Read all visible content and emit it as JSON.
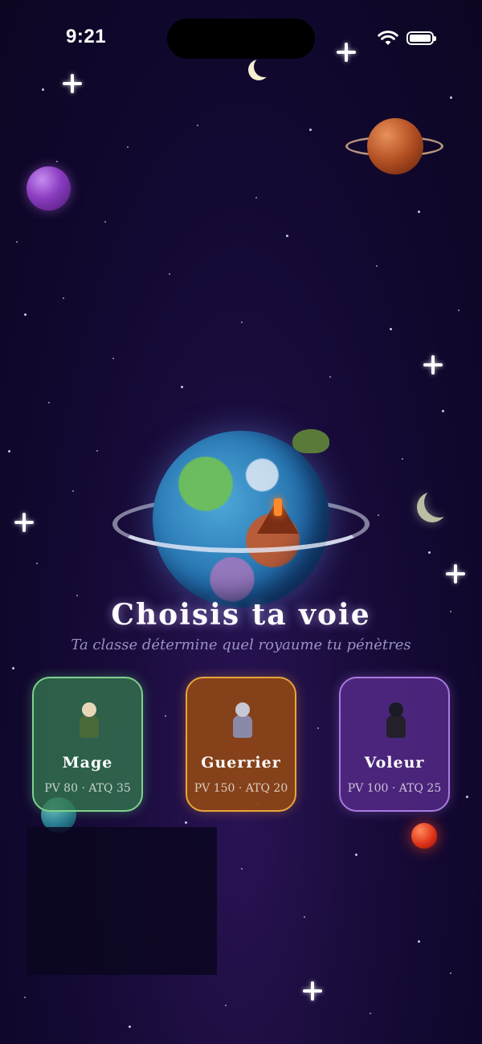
{
  "status_bar": {
    "time": "9:21"
  },
  "title": "Choisis ta voie",
  "subtitle": "Ta classe détermine quel royaume tu pénètres",
  "classes": [
    {
      "name": "Mage",
      "stats": "PV 80 · ATQ 35",
      "color": "#7fd18e"
    },
    {
      "name": "Guerrier",
      "stats": "PV 150 · ATQ 20",
      "color": "#e8a63a"
    },
    {
      "name": "Voleur",
      "stats": "PV 100 · ATQ 25",
      "color": "#a97ae0"
    }
  ],
  "icons": [
    "wifi-icon",
    "battery-icon",
    "sparkle-icon",
    "crescent-moon-icon",
    "planet-icon"
  ]
}
